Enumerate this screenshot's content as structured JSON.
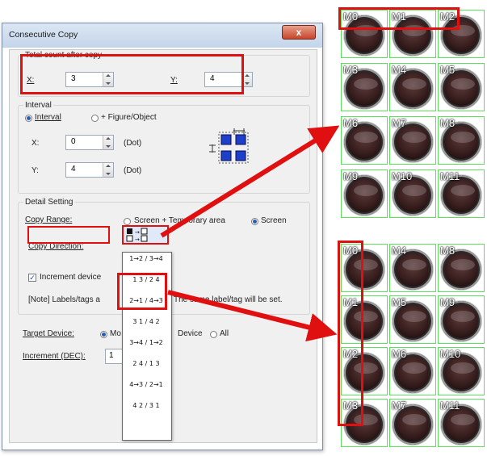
{
  "dialog": {
    "title": "Consecutive Copy",
    "close_label": "x",
    "total": {
      "label": "Total count after copy",
      "x_label": "X:",
      "x_value": "3",
      "y_label": "Y:",
      "y_value": "4"
    },
    "interval": {
      "label": "Interval",
      "opt_interval": "Interval",
      "opt_figure": "+ Figure/Object",
      "x_label": "X:",
      "x_value": "0",
      "x_unit": "(Dot)",
      "y_label": "Y:",
      "y_value": "4",
      "y_unit": "(Dot)"
    },
    "detail": {
      "label": "Detail Setting",
      "copy_range_label": "Copy Range:",
      "range_opt1": "Screen + Temporary area",
      "range_opt2": "Screen",
      "copy_direction_label": "Copy Direction:",
      "increment_device_label": "Increment device",
      "note_prefix": "[Note] Labels/tags a",
      "note_suffix": "The same label/tag will be set."
    },
    "target": {
      "label": "Target Device:",
      "opt1": "Mo",
      "opt2": "Device",
      "opt3": "All"
    },
    "increment": {
      "label": "Increment (DEC):",
      "value": "1"
    },
    "direction_options": [
      "1→2 / 3→4",
      "1→2 / 3→4",
      "1 3 / 2 4",
      "2→1 / 4→3",
      "3 1 / 4 2",
      "3→4 / 1→2",
      "2 4 / 1 3",
      "4→3 / 2→1",
      "4 2 / 3 1"
    ]
  },
  "grid_top": {
    "labels": [
      "M0",
      "M1",
      "M2",
      "M3",
      "M4",
      "M5",
      "M6",
      "M7",
      "M8",
      "M9",
      "M10",
      "M11"
    ]
  },
  "grid_bottom": {
    "labels": [
      "M0",
      "M4",
      "M8",
      "M1",
      "M5",
      "M9",
      "M2",
      "M6",
      "M10",
      "M3",
      "M7",
      "M11"
    ]
  },
  "colors": {
    "accent_red": "#e01010",
    "grid_border": "#5ce05c",
    "pattern_blue": "#1e3fc7"
  }
}
